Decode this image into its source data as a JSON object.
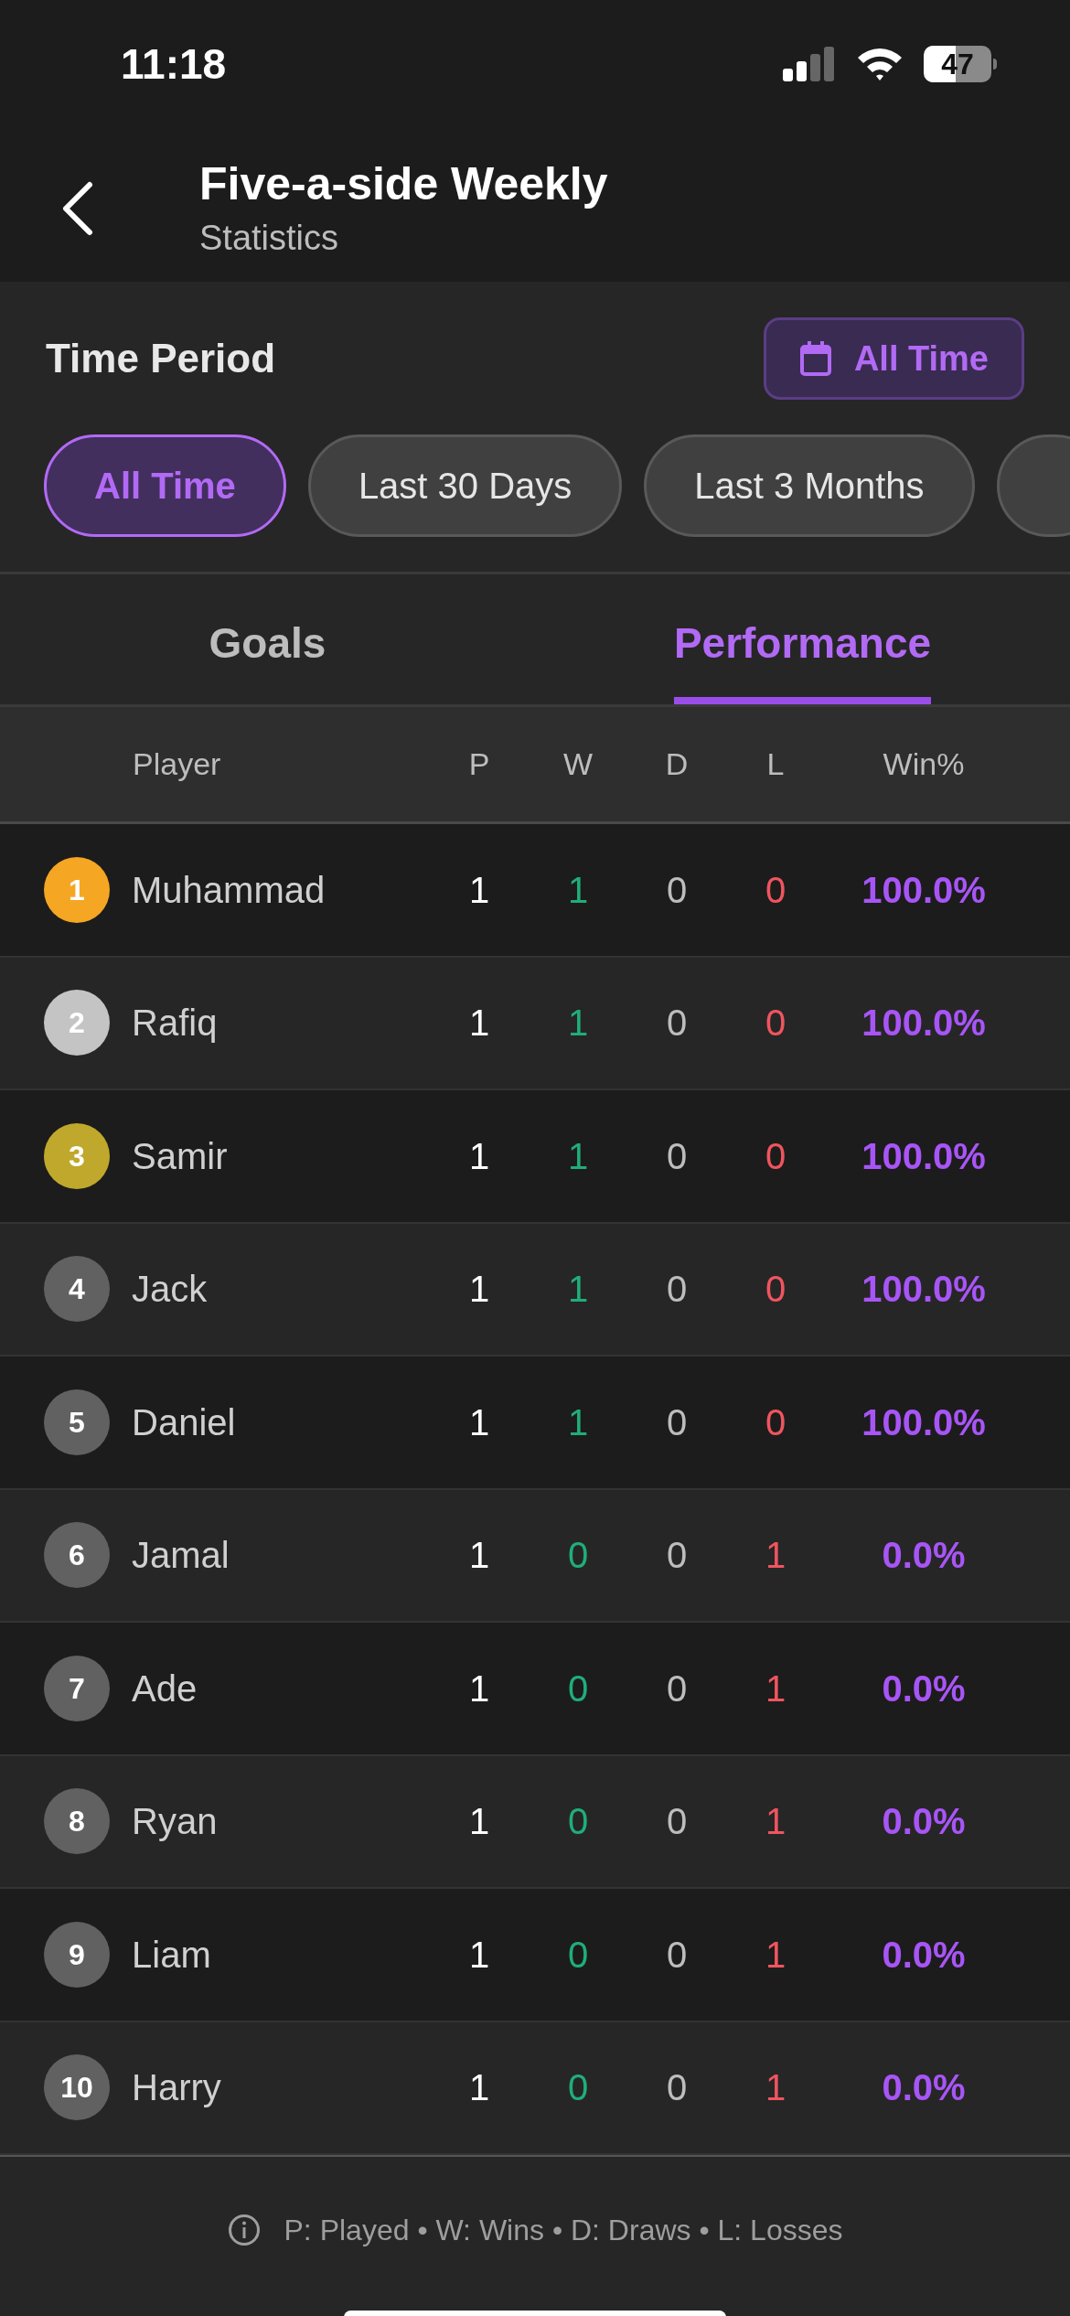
{
  "status_bar": {
    "time": "11:18",
    "battery": "47"
  },
  "header": {
    "title": "Five-a-side Weekly",
    "subtitle": "Statistics"
  },
  "time_period": {
    "label": "Time Period",
    "button": "All Time"
  },
  "filters": [
    {
      "label": "All Time",
      "selected": true
    },
    {
      "label": "Last 30 Days",
      "selected": false
    },
    {
      "label": "Last 3 Months",
      "selected": false
    }
  ],
  "tabs": [
    {
      "label": "Goals",
      "selected": false
    },
    {
      "label": "Performance",
      "selected": true
    }
  ],
  "table": {
    "columns": [
      "Player",
      "P",
      "W",
      "D",
      "L",
      "Win%"
    ],
    "rows": [
      {
        "rank": "1",
        "color": "#f5a623",
        "name": "Muhammad",
        "p": "1",
        "w": "1",
        "d": "0",
        "l": "0",
        "win": "100.0%"
      },
      {
        "rank": "2",
        "color": "#c4c4c4",
        "name": "Rafiq",
        "p": "1",
        "w": "1",
        "d": "0",
        "l": "0",
        "win": "100.0%"
      },
      {
        "rank": "3",
        "color": "#bfa82c",
        "name": "Samir",
        "p": "1",
        "w": "1",
        "d": "0",
        "l": "0",
        "win": "100.0%"
      },
      {
        "rank": "4",
        "color": "#616161",
        "name": "Jack",
        "p": "1",
        "w": "1",
        "d": "0",
        "l": "0",
        "win": "100.0%"
      },
      {
        "rank": "5",
        "color": "#616161",
        "name": "Daniel",
        "p": "1",
        "w": "1",
        "d": "0",
        "l": "0",
        "win": "100.0%"
      },
      {
        "rank": "6",
        "color": "#616161",
        "name": "Jamal",
        "p": "1",
        "w": "0",
        "d": "0",
        "l": "1",
        "win": "0.0%"
      },
      {
        "rank": "7",
        "color": "#616161",
        "name": "Ade",
        "p": "1",
        "w": "0",
        "d": "0",
        "l": "1",
        "win": "0.0%"
      },
      {
        "rank": "8",
        "color": "#616161",
        "name": "Ryan",
        "p": "1",
        "w": "0",
        "d": "0",
        "l": "1",
        "win": "0.0%"
      },
      {
        "rank": "9",
        "color": "#616161",
        "name": "Liam",
        "p": "1",
        "w": "0",
        "d": "0",
        "l": "1",
        "win": "0.0%"
      },
      {
        "rank": "10",
        "color": "#616161",
        "name": "Harry",
        "p": "1",
        "w": "0",
        "d": "0",
        "l": "1",
        "win": "0.0%"
      }
    ]
  },
  "legend": "P: Played • W: Wins • D: Draws • L: Losses"
}
